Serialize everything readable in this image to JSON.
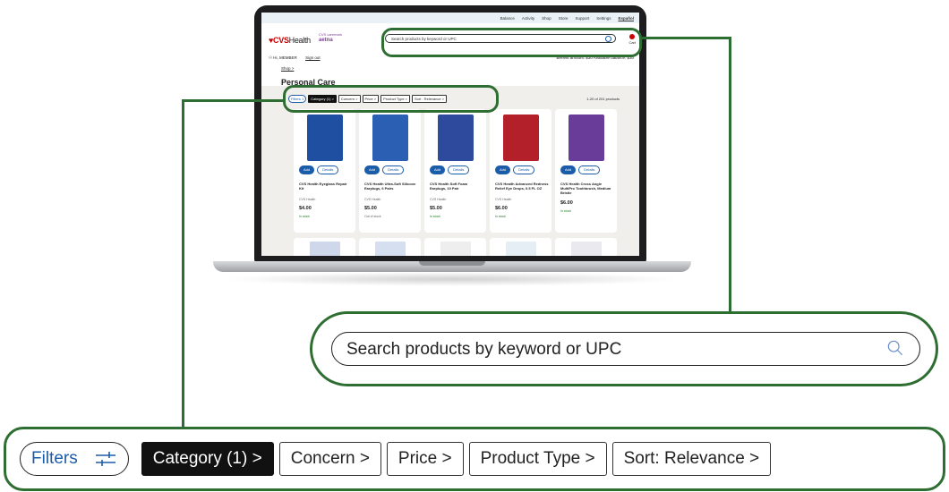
{
  "screen": {
    "top_links": [
      "Balance",
      "Activity",
      "Shop",
      "Store",
      "Support",
      "Settings",
      "Español"
    ],
    "brand": {
      "logo_text": "CVS",
      "logo_suffix": "Health",
      "partner_small": "CVS caremark",
      "partner": "aetna"
    },
    "search": {
      "placeholder": "Search products by keyword or UPC"
    },
    "cart_label": "Cart",
    "member": {
      "greeting": "Hi, MEMBER",
      "signout": "Sign out"
    },
    "benefit": {
      "text": "Benefit amount: $30   Available balance: $30"
    },
    "breadcrumb": "Shop >",
    "page_title": "Personal Care",
    "filters": [
      "Filters 1",
      "Category (1) >",
      "Concern >",
      "Price >",
      "Product Type >",
      "Sort : Relevance >"
    ],
    "results_count": "1-20 of 201 products",
    "product_buttons": {
      "add": "Add",
      "details": "Details"
    },
    "products": [
      {
        "name": "CVS Health Eyeglass Repair Kit",
        "brand": "CVS Health",
        "price": "$4.00",
        "stock": "In stock",
        "color": "#1f4fa0"
      },
      {
        "name": "CVS Health Ultra-Soft Silicone Earplugs, 6 Pairs",
        "brand": "CVS Health",
        "price": "$5.00",
        "stock": "Out of stock",
        "color": "#2a5fb4"
      },
      {
        "name": "CVS Health Soft Foam Earplugs, 10 Pair",
        "brand": "CVS Health",
        "price": "$5.00",
        "stock": "In stock",
        "color": "#2d4a9c"
      },
      {
        "name": "CVS Health Advanced Redness Relief Eye Drops, 0.5 FL OZ",
        "brand": "CVS Health",
        "price": "$6.00",
        "stock": "In stock",
        "color": "#b3202a"
      },
      {
        "name": "CVS Health Cross Angle MultiPro Toothbrush, Medium Bristle",
        "brand": "",
        "price": "$6.00",
        "stock": "In stock",
        "color": "#6a3c9a"
      }
    ]
  },
  "callout_search": {
    "placeholder": "Search products by keyword or UPC"
  },
  "callout_filters": {
    "filters_label": "Filters",
    "category": "Category (1) >",
    "concern": "Concern >",
    "price": "Price >",
    "product_type": "Product Type >",
    "sort": "Sort: Relevance >"
  },
  "colors": {
    "accent_green": "#2e6e32",
    "link_blue": "#1b5ca8",
    "brand_red": "#cc0000"
  }
}
